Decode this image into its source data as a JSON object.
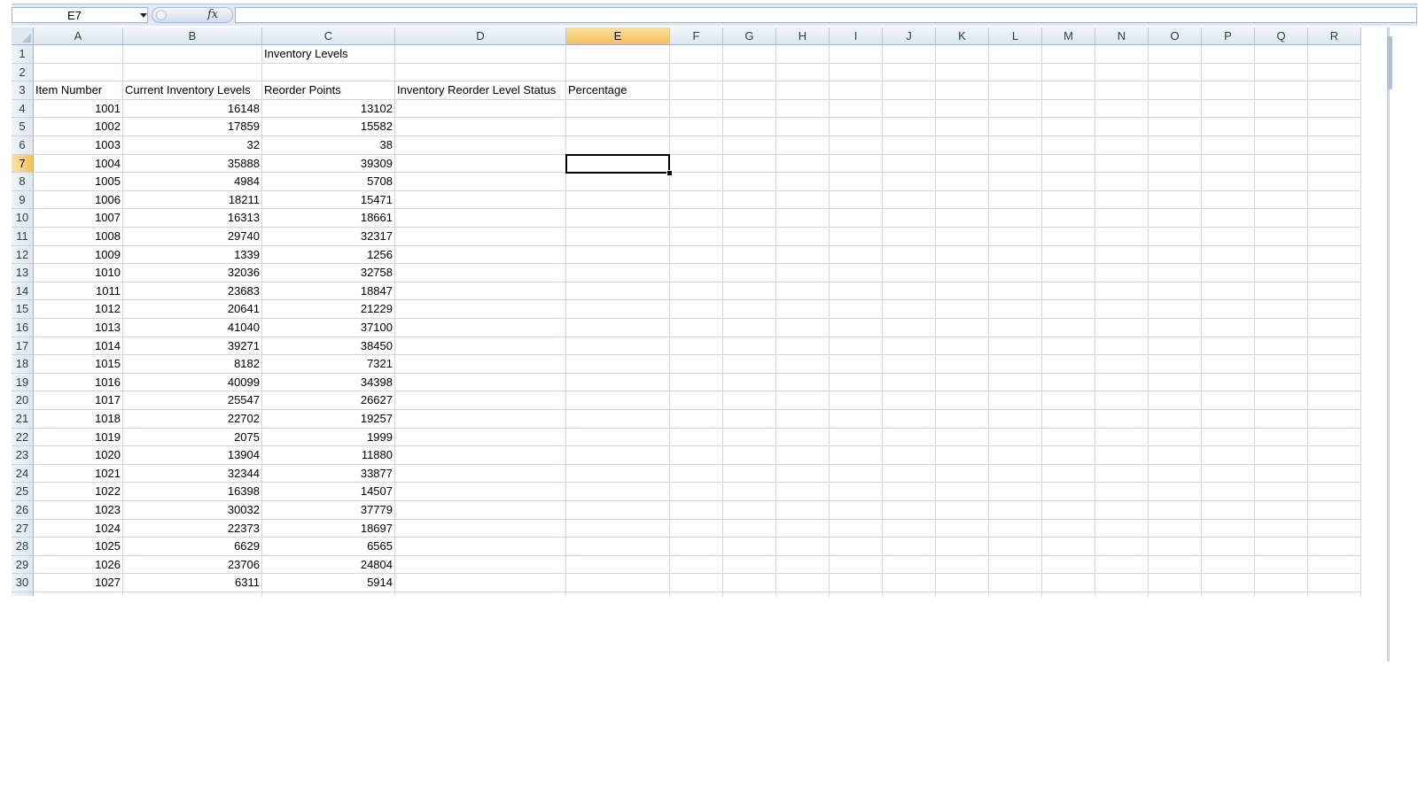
{
  "formula_bar": {
    "name_box": "E7",
    "fx_label": "fx",
    "formula_value": ""
  },
  "columns": [
    "A",
    "B",
    "C",
    "D",
    "E",
    "F",
    "G",
    "H",
    "I",
    "J",
    "K",
    "L",
    "M",
    "N",
    "O",
    "P",
    "Q",
    "R"
  ],
  "selected_column": "E",
  "selected_row": 7,
  "active_cell": "E7",
  "title": "Inventory Levels",
  "headers": {
    "item_number": "Item Number",
    "current_levels": "Current Inventory Levels",
    "reorder_points": "Reorder Points",
    "status": "Inventory Reorder Level Status",
    "percentage": "Percentage"
  },
  "rows": [
    {
      "item": "1001",
      "current": "16148",
      "reorder": "13102"
    },
    {
      "item": "1002",
      "current": "17859",
      "reorder": "15582"
    },
    {
      "item": "1003",
      "current": "32",
      "reorder": "38"
    },
    {
      "item": "1004",
      "current": "35888",
      "reorder": "39309"
    },
    {
      "item": "1005",
      "current": "4984",
      "reorder": "5708"
    },
    {
      "item": "1006",
      "current": "18211",
      "reorder": "15471"
    },
    {
      "item": "1007",
      "current": "16313",
      "reorder": "18661"
    },
    {
      "item": "1008",
      "current": "29740",
      "reorder": "32317"
    },
    {
      "item": "1009",
      "current": "1339",
      "reorder": "1256"
    },
    {
      "item": "1010",
      "current": "32036",
      "reorder": "32758"
    },
    {
      "item": "1011",
      "current": "23683",
      "reorder": "18847"
    },
    {
      "item": "1012",
      "current": "20641",
      "reorder": "21229"
    },
    {
      "item": "1013",
      "current": "41040",
      "reorder": "37100"
    },
    {
      "item": "1014",
      "current": "39271",
      "reorder": "38450"
    },
    {
      "item": "1015",
      "current": "8182",
      "reorder": "7321"
    },
    {
      "item": "1016",
      "current": "40099",
      "reorder": "34398"
    },
    {
      "item": "1017",
      "current": "25547",
      "reorder": "26627"
    },
    {
      "item": "1018",
      "current": "22702",
      "reorder": "19257"
    },
    {
      "item": "1019",
      "current": "2075",
      "reorder": "1999"
    },
    {
      "item": "1020",
      "current": "13904",
      "reorder": "11880"
    },
    {
      "item": "1021",
      "current": "32344",
      "reorder": "33877"
    },
    {
      "item": "1022",
      "current": "16398",
      "reorder": "14507"
    },
    {
      "item": "1023",
      "current": "30032",
      "reorder": "37779"
    },
    {
      "item": "1024",
      "current": "22373",
      "reorder": "18697"
    },
    {
      "item": "1025",
      "current": "6629",
      "reorder": "6565"
    },
    {
      "item": "1026",
      "current": "23706",
      "reorder": "24804"
    },
    {
      "item": "1027",
      "current": "6311",
      "reorder": "5914"
    }
  ]
}
